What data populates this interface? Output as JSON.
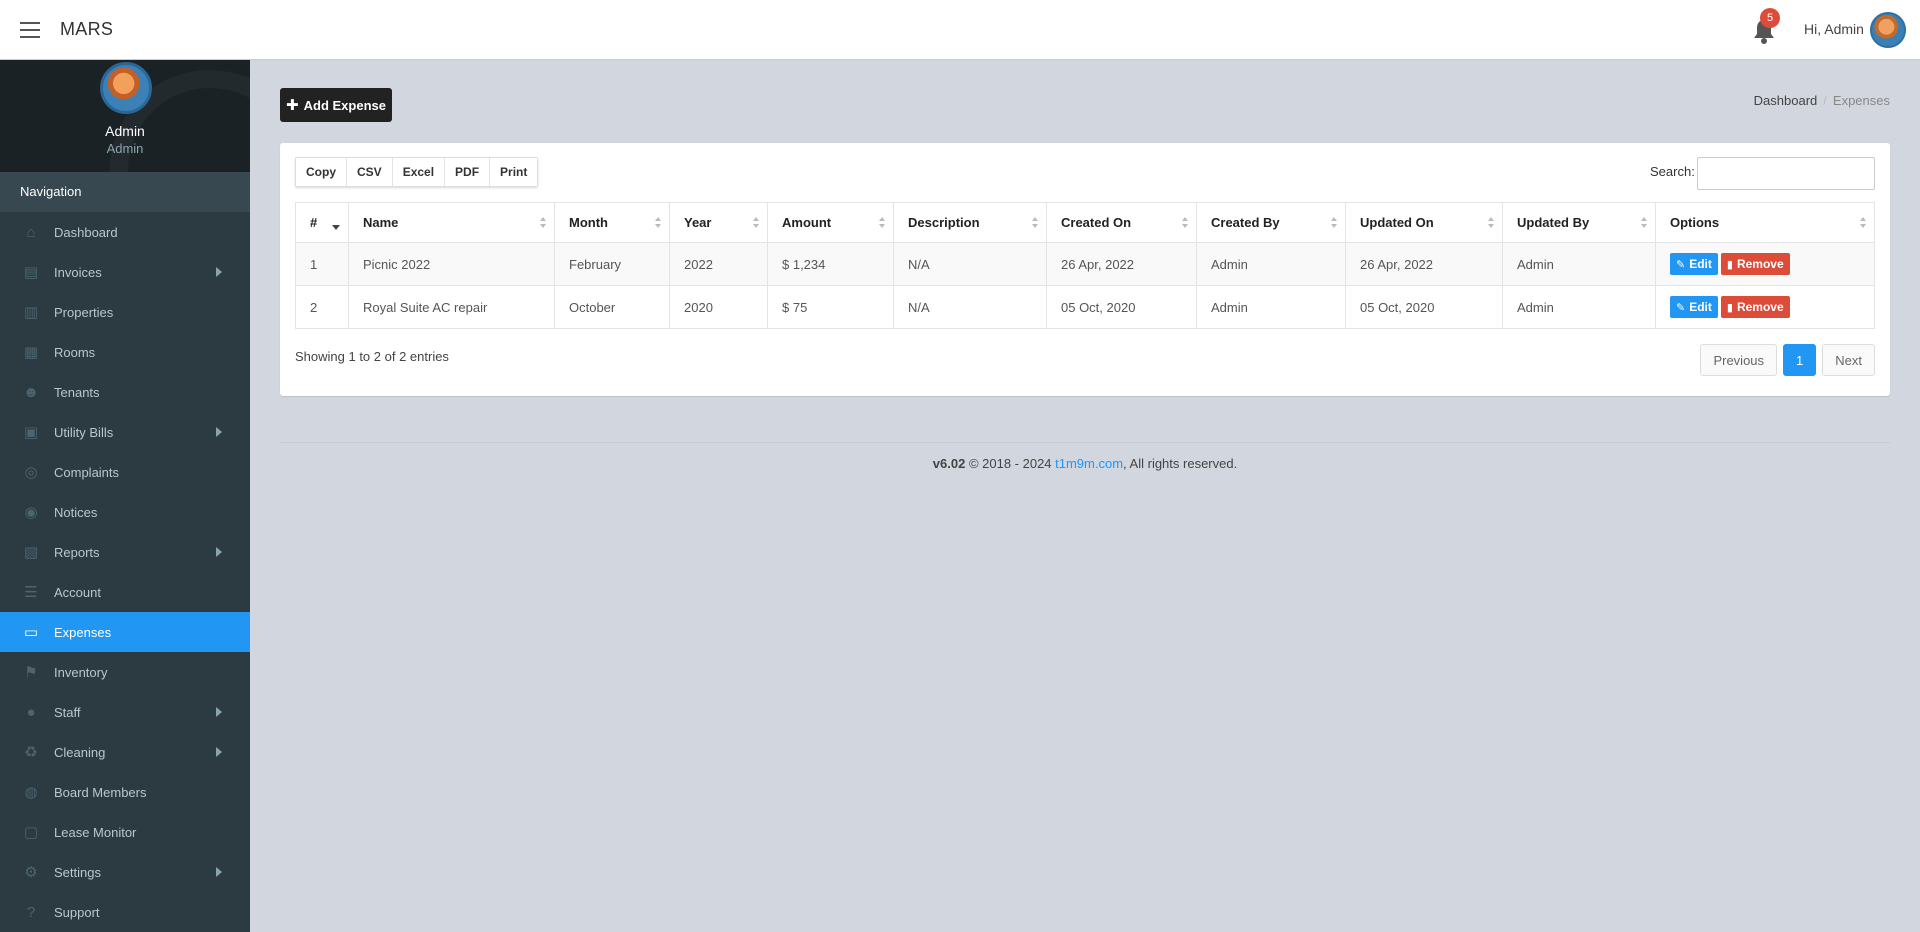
{
  "topbar": {
    "brand": "MARS",
    "notification_count": "5",
    "greeting": "Hi, Admin"
  },
  "sidebar": {
    "user_name": "Admin",
    "user_role": "Admin",
    "nav_header": "Navigation",
    "items": [
      {
        "label": "Dashboard",
        "icon": "home-icon",
        "glyph": "⌂",
        "submenu": false
      },
      {
        "label": "Invoices",
        "icon": "invoice-icon",
        "glyph": "▤",
        "submenu": true
      },
      {
        "label": "Properties",
        "icon": "building-icon",
        "glyph": "▥",
        "submenu": false
      },
      {
        "label": "Rooms",
        "icon": "room-icon",
        "glyph": "▦",
        "submenu": false
      },
      {
        "label": "Tenants",
        "icon": "users-icon",
        "glyph": "☻",
        "submenu": false
      },
      {
        "label": "Utility Bills",
        "icon": "money-icon",
        "glyph": "▣",
        "submenu": true
      },
      {
        "label": "Complaints",
        "icon": "lifebuoy-icon",
        "glyph": "◎",
        "submenu": false
      },
      {
        "label": "Notices",
        "icon": "podcast-icon",
        "glyph": "◉",
        "submenu": false
      },
      {
        "label": "Reports",
        "icon": "excel-file-icon",
        "glyph": "▧",
        "submenu": true
      },
      {
        "label": "Account",
        "icon": "list-icon",
        "glyph": "☰",
        "submenu": false
      },
      {
        "label": "Expenses",
        "icon": "credit-card-icon",
        "glyph": "▭",
        "submenu": false,
        "active": true
      },
      {
        "label": "Inventory",
        "icon": "flag-icon",
        "glyph": "⚑",
        "submenu": false
      },
      {
        "label": "Staff",
        "icon": "user-icon",
        "glyph": "●",
        "submenu": true
      },
      {
        "label": "Cleaning",
        "icon": "recycle-icon",
        "glyph": "♻",
        "submenu": true
      },
      {
        "label": "Board Members",
        "icon": "user-circle-icon",
        "glyph": "◍",
        "submenu": false
      },
      {
        "label": "Lease Monitor",
        "icon": "monitor-icon",
        "glyph": "▢",
        "submenu": false
      },
      {
        "label": "Settings",
        "icon": "gear-icon",
        "glyph": "⚙",
        "submenu": true
      },
      {
        "label": "Support",
        "icon": "question-icon",
        "glyph": "?",
        "submenu": false
      }
    ]
  },
  "toolbar": {
    "add_label": "Add Expense"
  },
  "breadcrumb": {
    "home": "Dashboard",
    "current": "Expenses"
  },
  "table_controls": {
    "export_buttons": [
      "Copy",
      "CSV",
      "Excel",
      "PDF",
      "Print"
    ],
    "search_label": "Search:",
    "search_value": ""
  },
  "table": {
    "columns": [
      "#",
      "Name",
      "Month",
      "Year",
      "Amount",
      "Description",
      "Created On",
      "Created By",
      "Updated On",
      "Updated By",
      "Options"
    ],
    "rows": [
      [
        "1",
        "Picnic 2022",
        "February",
        "2022",
        "$ 1,234",
        "N/A",
        "26 Apr, 2022",
        "Admin",
        "26 Apr, 2022",
        "Admin"
      ],
      [
        "2",
        "Royal Suite AC repair",
        "October",
        "2020",
        "$ 75",
        "N/A",
        "05 Oct, 2020",
        "Admin",
        "05 Oct, 2020",
        "Admin"
      ]
    ],
    "edit_label": "Edit",
    "remove_label": "Remove"
  },
  "pagination": {
    "info": "Showing 1 to 2 of 2 entries",
    "previous": "Previous",
    "current_page": "1",
    "next": "Next"
  },
  "footer": {
    "version": "v6.02",
    "copyright": " © 2018 - 2024 ",
    "link_text": "t1m9m.com",
    "rights": ", All rights reserved."
  },
  "colors": {
    "accent": "#2196f3",
    "danger": "#dd4b39",
    "sidebar_bg": "#2c3b41",
    "content_bg": "#d2d6de"
  }
}
